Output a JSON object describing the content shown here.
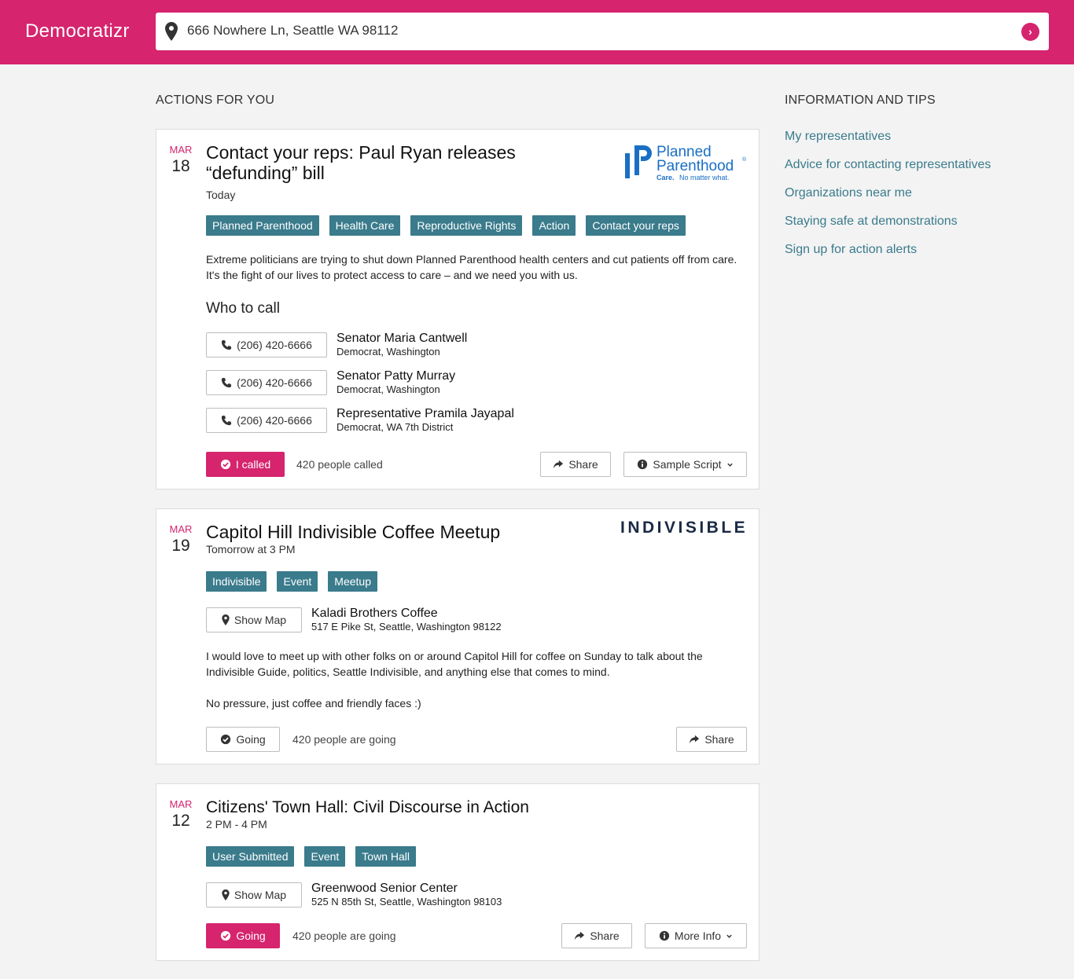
{
  "app": {
    "brand": "Democratizr"
  },
  "search": {
    "value": "666 Nowhere Ln, Seattle WA 98112",
    "go_icon": "chevron-right-icon"
  },
  "colors": {
    "accent": "#d6246e",
    "tag": "#3a7b8c",
    "link": "#3a7b8c"
  },
  "main": {
    "section_title": "ACTIONS FOR YOU"
  },
  "sidebar": {
    "title": "INFORMATION AND TIPS",
    "links": [
      "My representatives",
      "Advice for contacting representatives",
      "Organizations near me",
      "Staying safe at demonstrations",
      "Sign up for action alerts"
    ]
  },
  "cards": [
    {
      "month": "MAR",
      "day": "18",
      "title_line1": "Contact your reps: Paul Ryan releases",
      "title_line2": "“defunding” bill",
      "subtitle": "Today",
      "logo": {
        "name": "Planned",
        "name2": "Parenthood",
        "reg": "®",
        "tagline_bold": "Care.",
        "tagline": "No matter what."
      },
      "tags": [
        "Planned Parenthood",
        "Health Care",
        "Reproductive Rights",
        "Action",
        "Contact your reps"
      ],
      "description": "Extreme politicians are trying to shut down Planned Parenthood health centers and cut patients off from care. It's the fight of our lives to protect access to care – and we need you with us.",
      "who_title": "Who to call",
      "reps": [
        {
          "phone": "(206) 420-6666",
          "name": "Senator Maria Cantwell",
          "party": "Democrat, Washington"
        },
        {
          "phone": "(206) 420-6666",
          "name": "Senator Patty Murray",
          "party": "Democrat, Washington"
        },
        {
          "phone": "(206) 420-6666",
          "name": "Representative Pramila Jayapal",
          "party": "Democrat, WA 7th District"
        }
      ],
      "primary_button": "I called",
      "count": "420 people called",
      "share": "Share",
      "script": "Sample Script"
    },
    {
      "month": "MAR",
      "day": "19",
      "title": "Capitol Hill Indivisible Coffee Meetup",
      "subtitle": "Tomorrow at 3 PM",
      "logo_text": "INDIVISIBLE",
      "tags": [
        "Indivisible",
        "Event",
        "Meetup"
      ],
      "map_button": "Show Map",
      "location_name": "Kaladi Brothers Coffee",
      "location_addr": "517 E Pike St, Seattle, Washington 98122",
      "description": "I would love to meet up with other folks on or around Capitol Hill for coffee on Sunday to talk about the Indivisible Guide, politics, Seattle Indivisible, and anything else that comes to mind.",
      "description2": "No pressure, just coffee and friendly faces :)",
      "primary_button": "Going",
      "count": "420 people are going",
      "share": "Share"
    },
    {
      "month": "MAR",
      "day": "12",
      "title": "Citizens' Town Hall: Civil Discourse in Action",
      "subtitle": "2 PM - 4 PM",
      "tags": [
        "User Submitted",
        "Event",
        "Town Hall"
      ],
      "map_button": "Show Map",
      "location_name": "Greenwood Senior Center",
      "location_addr": "525 N 85th St, Seattle, Washington 98103",
      "primary_button": "Going",
      "count": "420 people are going",
      "share": "Share",
      "more": "More Info"
    }
  ]
}
